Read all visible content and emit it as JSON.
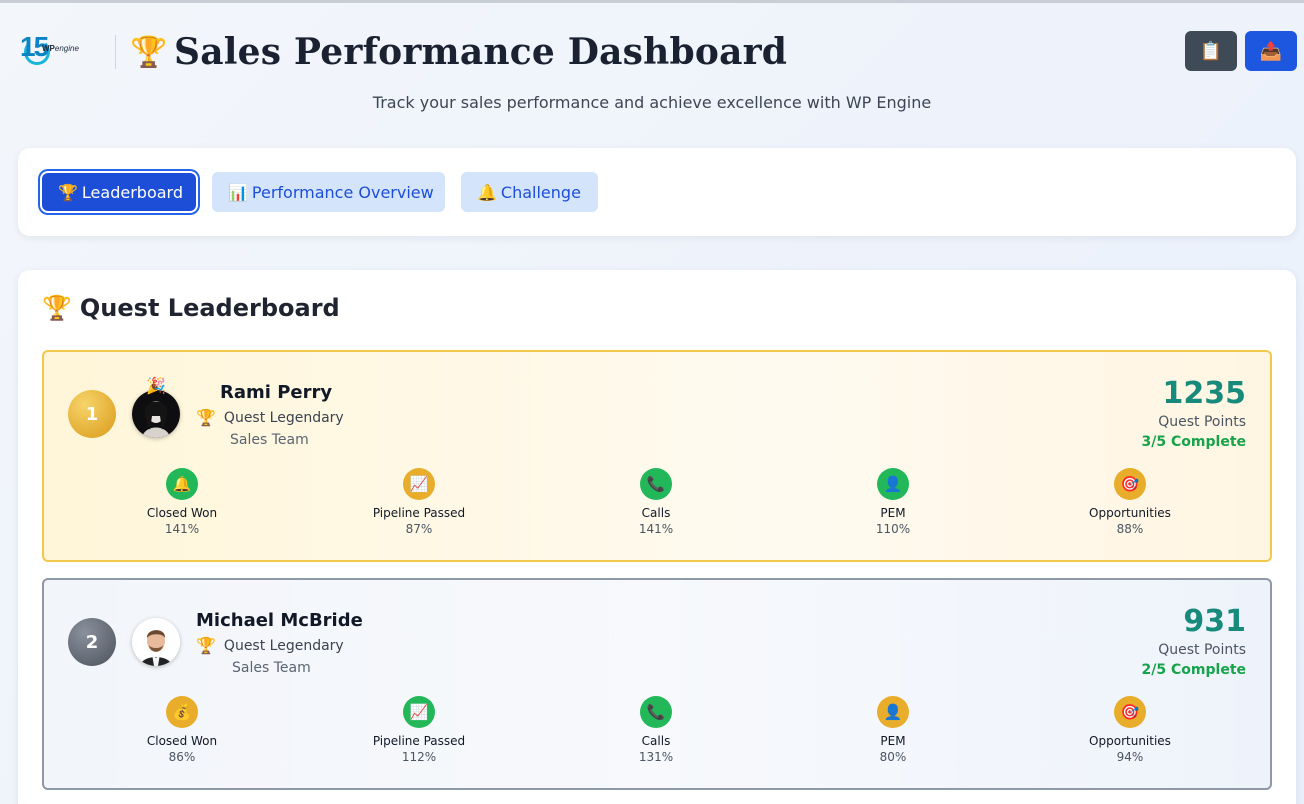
{
  "header": {
    "logo_number": "15",
    "logo_brand": "WP",
    "logo_brand_suffix": "engine",
    "title_icon": "🏆",
    "title": "Sales Performance Dashboard",
    "subtitle": "Track your sales performance and achieve excellence with WP Engine",
    "buttons": [
      {
        "icon": "clipboard-icon",
        "glyph": "📋"
      },
      {
        "icon": "inbox-upload-icon",
        "glyph": "📤"
      }
    ]
  },
  "tabs": [
    {
      "icon": "🏆",
      "label": "Leaderboard",
      "active": true
    },
    {
      "icon": "📊",
      "label": "Performance Overview",
      "active": false
    },
    {
      "icon": "🔔",
      "label": "Challenge",
      "active": false
    }
  ],
  "leaderboard": {
    "icon": "🏆",
    "title": "Quest Leaderboard",
    "entries": [
      {
        "rank": "1",
        "name": "Rami Perry",
        "title_icon": "🏆",
        "title": "Quest Legendary",
        "team": "Sales Team",
        "points": "1235",
        "points_label": "Quest Points",
        "complete": "3/5 Complete",
        "metrics": [
          {
            "icon": "🔔",
            "label": "Closed Won",
            "value": "141%",
            "status": "green"
          },
          {
            "icon": "📈",
            "label": "Pipeline Passed",
            "value": "87%",
            "status": "amber"
          },
          {
            "icon": "📞",
            "label": "Calls",
            "value": "141%",
            "status": "green"
          },
          {
            "icon": "👤",
            "label": "PEM",
            "value": "110%",
            "status": "green"
          },
          {
            "icon": "🎯",
            "label": "Opportunities",
            "value": "88%",
            "status": "amber"
          }
        ]
      },
      {
        "rank": "2",
        "name": "Michael McBride",
        "title_icon": "🏆",
        "title": "Quest Legendary",
        "team": "Sales Team",
        "points": "931",
        "points_label": "Quest Points",
        "complete": "2/5 Complete",
        "metrics": [
          {
            "icon": "💰",
            "label": "Closed Won",
            "value": "86%",
            "status": "amber"
          },
          {
            "icon": "📈",
            "label": "Pipeline Passed",
            "value": "112%",
            "status": "green"
          },
          {
            "icon": "📞",
            "label": "Calls",
            "value": "131%",
            "status": "green"
          },
          {
            "icon": "👤",
            "label": "PEM",
            "value": "80%",
            "status": "amber"
          },
          {
            "icon": "🎯",
            "label": "Opportunities",
            "value": "94%",
            "status": "amber"
          }
        ]
      }
    ]
  },
  "colors": {
    "accent": "#1d4ed8",
    "points": "#178a7b",
    "complete": "#16a34a",
    "gold_border": "#f2c84b",
    "silver_border": "#8f98a6",
    "metric_green": "#22b85a",
    "metric_amber": "#e8ad2a"
  }
}
